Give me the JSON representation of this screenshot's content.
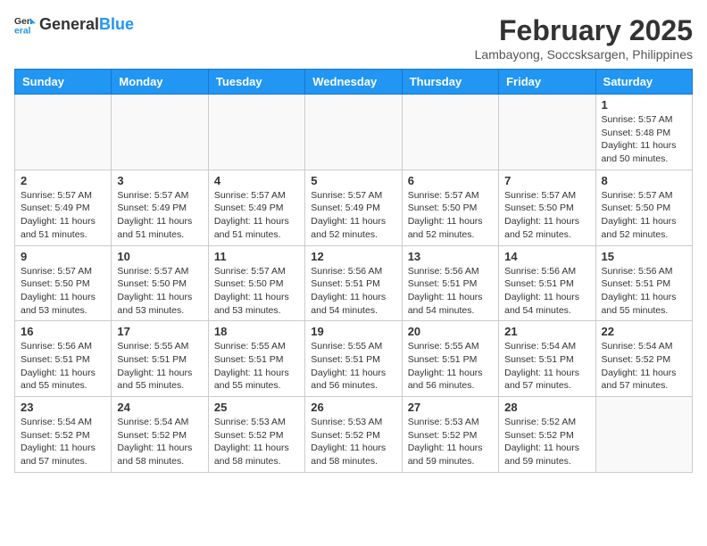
{
  "header": {
    "logo_general": "General",
    "logo_blue": "Blue",
    "month_year": "February 2025",
    "location": "Lambayong, Soccsksargen, Philippines"
  },
  "weekdays": [
    "Sunday",
    "Monday",
    "Tuesday",
    "Wednesday",
    "Thursday",
    "Friday",
    "Saturday"
  ],
  "weeks": [
    [
      {
        "day": "",
        "info": ""
      },
      {
        "day": "",
        "info": ""
      },
      {
        "day": "",
        "info": ""
      },
      {
        "day": "",
        "info": ""
      },
      {
        "day": "",
        "info": ""
      },
      {
        "day": "",
        "info": ""
      },
      {
        "day": "1",
        "info": "Sunrise: 5:57 AM\nSunset: 5:48 PM\nDaylight: 11 hours and 50 minutes."
      }
    ],
    [
      {
        "day": "2",
        "info": "Sunrise: 5:57 AM\nSunset: 5:49 PM\nDaylight: 11 hours and 51 minutes."
      },
      {
        "day": "3",
        "info": "Sunrise: 5:57 AM\nSunset: 5:49 PM\nDaylight: 11 hours and 51 minutes."
      },
      {
        "day": "4",
        "info": "Sunrise: 5:57 AM\nSunset: 5:49 PM\nDaylight: 11 hours and 51 minutes."
      },
      {
        "day": "5",
        "info": "Sunrise: 5:57 AM\nSunset: 5:49 PM\nDaylight: 11 hours and 52 minutes."
      },
      {
        "day": "6",
        "info": "Sunrise: 5:57 AM\nSunset: 5:50 PM\nDaylight: 11 hours and 52 minutes."
      },
      {
        "day": "7",
        "info": "Sunrise: 5:57 AM\nSunset: 5:50 PM\nDaylight: 11 hours and 52 minutes."
      },
      {
        "day": "8",
        "info": "Sunrise: 5:57 AM\nSunset: 5:50 PM\nDaylight: 11 hours and 52 minutes."
      }
    ],
    [
      {
        "day": "9",
        "info": "Sunrise: 5:57 AM\nSunset: 5:50 PM\nDaylight: 11 hours and 53 minutes."
      },
      {
        "day": "10",
        "info": "Sunrise: 5:57 AM\nSunset: 5:50 PM\nDaylight: 11 hours and 53 minutes."
      },
      {
        "day": "11",
        "info": "Sunrise: 5:57 AM\nSunset: 5:50 PM\nDaylight: 11 hours and 53 minutes."
      },
      {
        "day": "12",
        "info": "Sunrise: 5:56 AM\nSunset: 5:51 PM\nDaylight: 11 hours and 54 minutes."
      },
      {
        "day": "13",
        "info": "Sunrise: 5:56 AM\nSunset: 5:51 PM\nDaylight: 11 hours and 54 minutes."
      },
      {
        "day": "14",
        "info": "Sunrise: 5:56 AM\nSunset: 5:51 PM\nDaylight: 11 hours and 54 minutes."
      },
      {
        "day": "15",
        "info": "Sunrise: 5:56 AM\nSunset: 5:51 PM\nDaylight: 11 hours and 55 minutes."
      }
    ],
    [
      {
        "day": "16",
        "info": "Sunrise: 5:56 AM\nSunset: 5:51 PM\nDaylight: 11 hours and 55 minutes."
      },
      {
        "day": "17",
        "info": "Sunrise: 5:55 AM\nSunset: 5:51 PM\nDaylight: 11 hours and 55 minutes."
      },
      {
        "day": "18",
        "info": "Sunrise: 5:55 AM\nSunset: 5:51 PM\nDaylight: 11 hours and 55 minutes."
      },
      {
        "day": "19",
        "info": "Sunrise: 5:55 AM\nSunset: 5:51 PM\nDaylight: 11 hours and 56 minutes."
      },
      {
        "day": "20",
        "info": "Sunrise: 5:55 AM\nSunset: 5:51 PM\nDaylight: 11 hours and 56 minutes."
      },
      {
        "day": "21",
        "info": "Sunrise: 5:54 AM\nSunset: 5:51 PM\nDaylight: 11 hours and 57 minutes."
      },
      {
        "day": "22",
        "info": "Sunrise: 5:54 AM\nSunset: 5:52 PM\nDaylight: 11 hours and 57 minutes."
      }
    ],
    [
      {
        "day": "23",
        "info": "Sunrise: 5:54 AM\nSunset: 5:52 PM\nDaylight: 11 hours and 57 minutes."
      },
      {
        "day": "24",
        "info": "Sunrise: 5:54 AM\nSunset: 5:52 PM\nDaylight: 11 hours and 58 minutes."
      },
      {
        "day": "25",
        "info": "Sunrise: 5:53 AM\nSunset: 5:52 PM\nDaylight: 11 hours and 58 minutes."
      },
      {
        "day": "26",
        "info": "Sunrise: 5:53 AM\nSunset: 5:52 PM\nDaylight: 11 hours and 58 minutes."
      },
      {
        "day": "27",
        "info": "Sunrise: 5:53 AM\nSunset: 5:52 PM\nDaylight: 11 hours and 59 minutes."
      },
      {
        "day": "28",
        "info": "Sunrise: 5:52 AM\nSunset: 5:52 PM\nDaylight: 11 hours and 59 minutes."
      },
      {
        "day": "",
        "info": ""
      }
    ]
  ]
}
